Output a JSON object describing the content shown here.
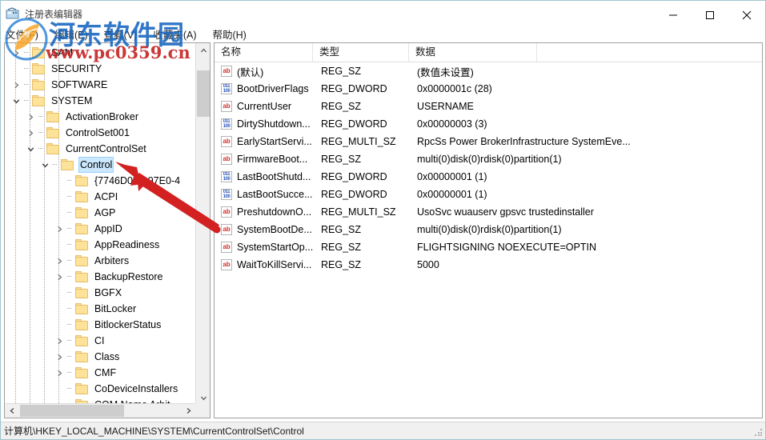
{
  "window": {
    "title": "注册表编辑器",
    "icon": "registry-editor-icon",
    "minimize_label": "—",
    "maximize_label": "□",
    "close_label": "✕"
  },
  "menubar": {
    "items": [
      {
        "label": "文件(F)",
        "name": "menu-file"
      },
      {
        "label": "编辑(E)",
        "name": "menu-edit"
      },
      {
        "label": "查看(V)",
        "name": "menu-view"
      },
      {
        "label": "收藏夹(A)",
        "name": "menu-favorites"
      },
      {
        "label": "帮助(H)",
        "name": "menu-help"
      }
    ]
  },
  "tree": {
    "nodes": [
      {
        "label": "SAM",
        "indent": 1,
        "twist": "collapsed",
        "selected": false
      },
      {
        "label": "SECURITY",
        "indent": 1,
        "twist": "none",
        "selected": false
      },
      {
        "label": "SOFTWARE",
        "indent": 1,
        "twist": "collapsed",
        "selected": false
      },
      {
        "label": "SYSTEM",
        "indent": 1,
        "twist": "expanded",
        "selected": false
      },
      {
        "label": "ActivationBroker",
        "indent": 2,
        "twist": "collapsed",
        "selected": false
      },
      {
        "label": "ControlSet001",
        "indent": 2,
        "twist": "collapsed",
        "selected": false
      },
      {
        "label": "CurrentControlSet",
        "indent": 2,
        "twist": "expanded",
        "selected": false
      },
      {
        "label": "Control",
        "indent": 3,
        "twist": "expanded",
        "selected": true
      },
      {
        "label": "{7746D00F-97E0-4",
        "indent": 4,
        "twist": "none",
        "selected": false
      },
      {
        "label": "ACPI",
        "indent": 4,
        "twist": "none",
        "selected": false
      },
      {
        "label": "AGP",
        "indent": 4,
        "twist": "none",
        "selected": false
      },
      {
        "label": "AppID",
        "indent": 4,
        "twist": "collapsed",
        "selected": false
      },
      {
        "label": "AppReadiness",
        "indent": 4,
        "twist": "none",
        "selected": false
      },
      {
        "label": "Arbiters",
        "indent": 4,
        "twist": "collapsed",
        "selected": false
      },
      {
        "label": "BackupRestore",
        "indent": 4,
        "twist": "collapsed",
        "selected": false
      },
      {
        "label": "BGFX",
        "indent": 4,
        "twist": "none",
        "selected": false
      },
      {
        "label": "BitLocker",
        "indent": 4,
        "twist": "none",
        "selected": false
      },
      {
        "label": "BitlockerStatus",
        "indent": 4,
        "twist": "none",
        "selected": false
      },
      {
        "label": "CI",
        "indent": 4,
        "twist": "collapsed",
        "selected": false
      },
      {
        "label": "Class",
        "indent": 4,
        "twist": "collapsed",
        "selected": false
      },
      {
        "label": "CMF",
        "indent": 4,
        "twist": "collapsed",
        "selected": false
      },
      {
        "label": "CoDeviceInstallers",
        "indent": 4,
        "twist": "none",
        "selected": false
      },
      {
        "label": "COM Name Arbit",
        "indent": 4,
        "twist": "none",
        "selected": false
      }
    ]
  },
  "list": {
    "columns": [
      {
        "label": "名称",
        "name": "column-name"
      },
      {
        "label": "类型",
        "name": "column-type"
      },
      {
        "label": "数据",
        "name": "column-data"
      }
    ],
    "rows": [
      {
        "icon": "string-value-icon",
        "kind": "sz",
        "name": "(默认)",
        "type": "REG_SZ",
        "data": "(数值未设置)"
      },
      {
        "icon": "dword-value-icon",
        "kind": "dw",
        "name": "BootDriverFlags",
        "type": "REG_DWORD",
        "data": "0x0000001c (28)"
      },
      {
        "icon": "string-value-icon",
        "kind": "sz",
        "name": "CurrentUser",
        "type": "REG_SZ",
        "data": "USERNAME"
      },
      {
        "icon": "dword-value-icon",
        "kind": "dw",
        "name": "DirtyShutdown...",
        "type": "REG_DWORD",
        "data": "0x00000003 (3)"
      },
      {
        "icon": "string-value-icon",
        "kind": "sz",
        "name": "EarlyStartServi...",
        "type": "REG_MULTI_SZ",
        "data": "RpcSs Power BrokerInfrastructure SystemEve..."
      },
      {
        "icon": "string-value-icon",
        "kind": "sz",
        "name": "FirmwareBoot...",
        "type": "REG_SZ",
        "data": "multi(0)disk(0)rdisk(0)partition(1)"
      },
      {
        "icon": "dword-value-icon",
        "kind": "dw",
        "name": "LastBootShutd...",
        "type": "REG_DWORD",
        "data": "0x00000001 (1)"
      },
      {
        "icon": "dword-value-icon",
        "kind": "dw",
        "name": "LastBootSucce...",
        "type": "REG_DWORD",
        "data": "0x00000001 (1)"
      },
      {
        "icon": "string-value-icon",
        "kind": "sz",
        "name": "PreshutdownO...",
        "type": "REG_MULTI_SZ",
        "data": "UsoSvc wuauserv gpsvc trustedinstaller"
      },
      {
        "icon": "string-value-icon",
        "kind": "sz",
        "name": "SystemBootDe...",
        "type": "REG_SZ",
        "data": "multi(0)disk(0)rdisk(0)partition(1)"
      },
      {
        "icon": "string-value-icon",
        "kind": "sz",
        "name": "SystemStartOp...",
        "type": "REG_SZ",
        "data": " FLIGHTSIGNING  NOEXECUTE=OPTIN"
      },
      {
        "icon": "string-value-icon",
        "kind": "sz",
        "name": "WaitToKillServi...",
        "type": "REG_SZ",
        "data": "5000"
      }
    ]
  },
  "statusbar": {
    "path": "计算机\\HKEY_LOCAL_MACHINE\\SYSTEM\\CurrentControlSet\\Control"
  },
  "watermark": {
    "site_cn": "河东软件园",
    "site_url": "www.pc0359.cn"
  },
  "colors": {
    "selection_blue": "#cce8ff",
    "folder_yellow": "#fde29a",
    "annotation_red": "#d32020",
    "watermark_blue": "#1565c0",
    "watermark_red": "#c62828",
    "titlebar_border": "#9ec4cf"
  }
}
